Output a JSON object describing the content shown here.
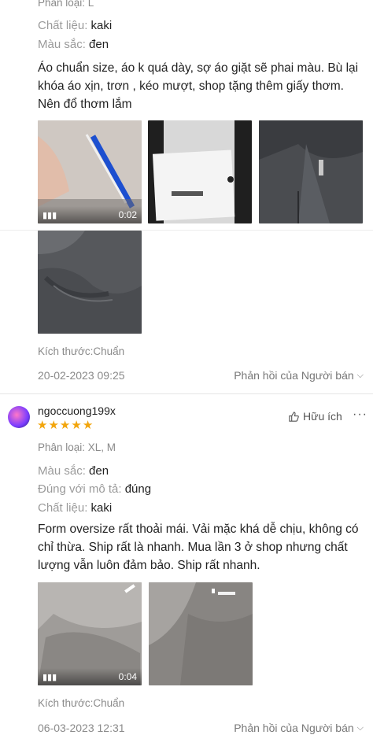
{
  "review1": {
    "variant_partial": "Phân loại: L",
    "fields": [
      {
        "label": "Chất liệu:",
        "value": "kaki"
      },
      {
        "label": "Màu sắc:",
        "value": "đen"
      }
    ],
    "text": "Áo chuẩn size, áo k quá dày, sợ áo giặt sẽ phai màu. Bù lại khóa áo xịn, trơn , kéo mượt, shop tặng thêm giấy thơm. Nên đổ thơm lắm",
    "video_duration": "0:02",
    "size_line": "Kích thước:Chuẩn",
    "date": "20-02-2023 09:25",
    "reply_label": "Phản hồi của Người bán"
  },
  "review2": {
    "username": "ngoccuong199x",
    "stars": 5,
    "helpful_label": "Hữu ích",
    "variant": "Phân loại: XL, M",
    "fields": [
      {
        "label": "Màu sắc:",
        "value": "đen"
      },
      {
        "label": "Đúng với mô tả:",
        "value": "đúng"
      },
      {
        "label": "Chất liệu:",
        "value": "kaki"
      }
    ],
    "text": "Form oversize rất thoải mái. Vải mặc khá dễ chịu, không có chỉ thừa. Ship rất là nhanh. Mua lần 3 ở shop nhưng chất lượng vẫn luôn đảm bảo. Ship rất nhanh.",
    "video_duration": "0:04",
    "size_line": "Kích thước:Chuẩn",
    "date": "06-03-2023 12:31",
    "reply_label": "Phản hồi của Người bán"
  },
  "colors": {
    "star": "#f2a50c",
    "text": "#222222",
    "muted": "#9a9a9a"
  }
}
